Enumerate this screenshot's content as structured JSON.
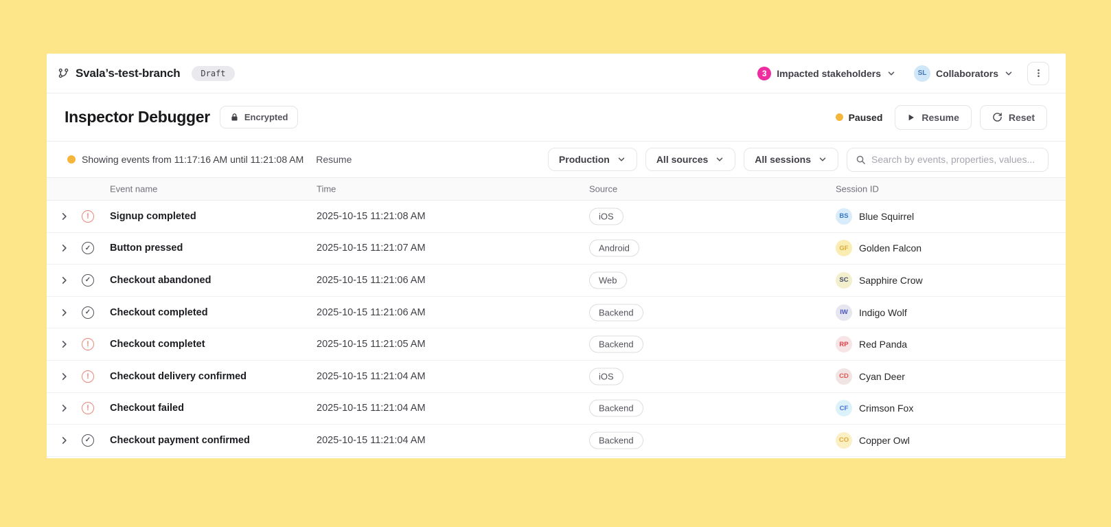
{
  "header": {
    "branch_name": "Svala’s-test-branch",
    "draft_badge": "Draft",
    "stakeholders": {
      "count": "3",
      "label": "Impacted stakeholders"
    },
    "collaborators": {
      "avatar_initials": "SL",
      "label": "Collaborators"
    }
  },
  "toolbar": {
    "title": "Inspector Debugger",
    "encrypted_label": "Encrypted",
    "status_label": "Paused",
    "resume_label": "Resume",
    "reset_label": "Reset"
  },
  "filter_bar": {
    "status_text": "Showing events from 11:17:16 AM until 11:21:08 AM",
    "resume_link": "Resume",
    "environment_dropdown": "Production",
    "sources_dropdown": "All sources",
    "sessions_dropdown": "All sessions",
    "search_placeholder": "Search by events, properties, values..."
  },
  "table": {
    "columns": [
      "Event name",
      "Time",
      "Source",
      "Session ID"
    ],
    "rows": [
      {
        "status": "error",
        "event": "Signup completed",
        "time": "2025-10-15 11:21:08 AM",
        "source": "iOS",
        "session_initials": "BS",
        "session_name": "Blue Squirrel",
        "avatar_bg": "#d9ecfb",
        "avatar_color": "#3178c6"
      },
      {
        "status": "success",
        "event": "Button pressed",
        "time": "2025-10-15 11:21:07 AM",
        "source": "Android",
        "session_initials": "GF",
        "session_name": "Golden Falcon",
        "avatar_bg": "#f9edb2",
        "avatar_color": "#d9ab3a"
      },
      {
        "status": "success",
        "event": "Checkout abandoned",
        "time": "2025-10-15 11:21:06 AM",
        "source": "Web",
        "session_initials": "SC",
        "session_name": "Sapphire Crow",
        "avatar_bg": "#f3efcd",
        "avatar_color": "#44506b"
      },
      {
        "status": "success",
        "event": "Checkout completed",
        "time": "2025-10-15 11:21:06 AM",
        "source": "Backend",
        "session_initials": "IW",
        "session_name": "Indigo Wolf",
        "avatar_bg": "#e6e6f0",
        "avatar_color": "#4956c4"
      },
      {
        "status": "error",
        "event": "Checkout completet",
        "time": "2025-10-15 11:21:05 AM",
        "source": "Backend",
        "session_initials": "RP",
        "session_name": "Red Panda",
        "avatar_bg": "#f6e4e6",
        "avatar_color": "#e23d44"
      },
      {
        "status": "error",
        "event": "Checkout delivery confirmed",
        "time": "2025-10-15 11:21:04 AM",
        "source": "iOS",
        "session_initials": "CD",
        "session_name": "Cyan Deer",
        "avatar_bg": "#f1e4e4",
        "avatar_color": "#e2584e"
      },
      {
        "status": "error",
        "event": "Checkout failed",
        "time": "2025-10-15 11:21:04 AM",
        "source": "Backend",
        "session_initials": "CF",
        "session_name": "Crimson Fox",
        "avatar_bg": "#dbf2fb",
        "avatar_color": "#4b70da"
      },
      {
        "status": "success",
        "event": "Checkout payment confirmed",
        "time": "2025-10-15 11:21:04 AM",
        "source": "Backend",
        "session_initials": "CO",
        "session_name": "Copper Owl",
        "avatar_bg": "#faf0c4",
        "avatar_color": "#e2a83b"
      }
    ]
  },
  "icons": {
    "error_glyph": "!",
    "check_glyph": "✓"
  },
  "colors": {
    "page_background": "#fde68a",
    "status_dot": "#f4b73c",
    "error_icon": "#ef8477",
    "success_icon": "#52525b",
    "stakeholders_badge": "#ed2da0",
    "collaborator_avatar_bg": "#cfe7f9",
    "collaborator_avatar_text": "#4477b5"
  }
}
